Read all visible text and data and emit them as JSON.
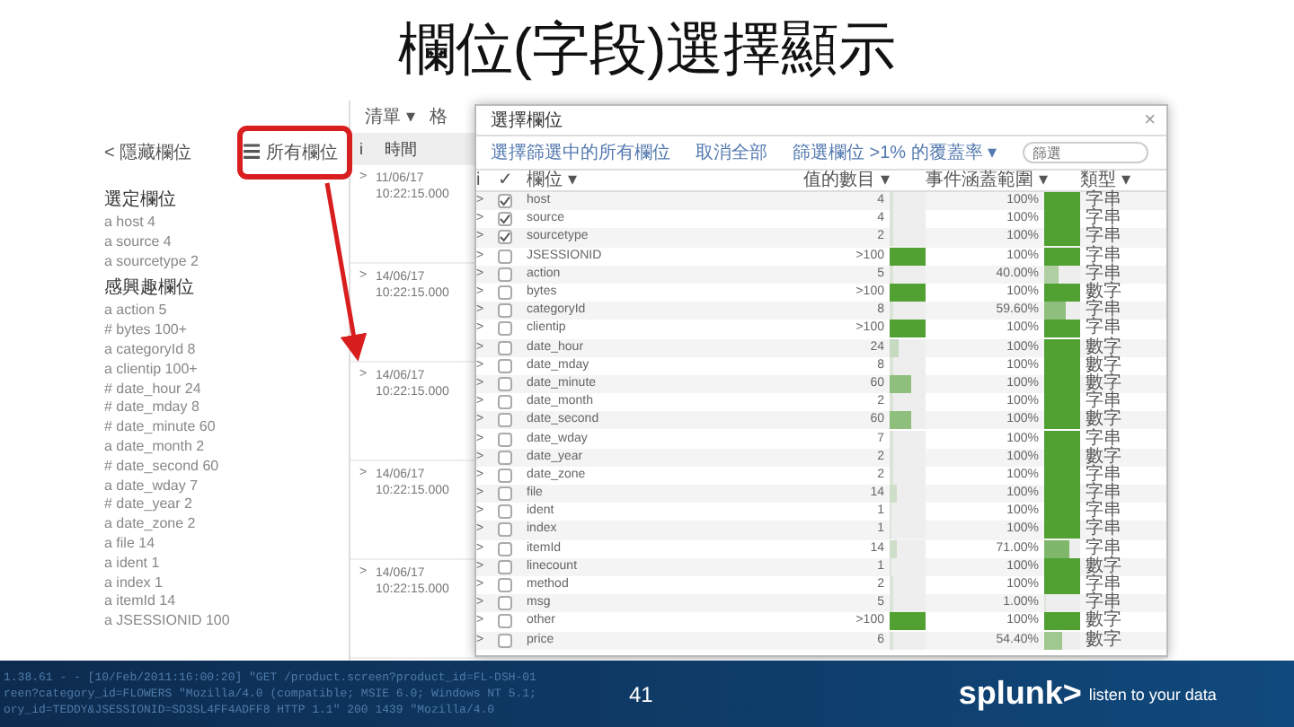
{
  "title": "欄位(字段)選擇顯示",
  "sidebar": {
    "hide_link": "< 隱藏欄位",
    "all_fields_button": "☰ 所有欄位",
    "sections": [
      {
        "heading": "選定欄位",
        "fields": [
          {
            "type": "a",
            "name": "host",
            "count": "4"
          },
          {
            "type": "a",
            "name": "source",
            "count": "4"
          },
          {
            "type": "a",
            "name": "sourcetype",
            "count": "2"
          }
        ]
      },
      {
        "heading": "感興趣欄位",
        "fields": [
          {
            "type": "a",
            "name": "action",
            "count": "5"
          },
          {
            "type": "#",
            "name": "bytes",
            "count": "100+"
          },
          {
            "type": "a",
            "name": "categoryId",
            "count": "8"
          },
          {
            "type": "a",
            "name": "clientip",
            "count": "100+"
          },
          {
            "type": "#",
            "name": "date_hour",
            "count": "24"
          },
          {
            "type": "#",
            "name": "date_mday",
            "count": "8"
          },
          {
            "type": "#",
            "name": "date_minute",
            "count": "60"
          },
          {
            "type": "a",
            "name": "date_month",
            "count": "2"
          },
          {
            "type": "#",
            "name": "date_second",
            "count": "60"
          },
          {
            "type": "a",
            "name": "date_wday",
            "count": "7"
          },
          {
            "type": "#",
            "name": "date_year",
            "count": "2"
          },
          {
            "type": "a",
            "name": "date_zone",
            "count": "2"
          },
          {
            "type": "a",
            "name": "file",
            "count": "14"
          },
          {
            "type": "a",
            "name": "ident",
            "count": "1"
          },
          {
            "type": "a",
            "name": "index",
            "count": "1"
          },
          {
            "type": "a",
            "name": "itemId",
            "count": "14"
          },
          {
            "type": "a",
            "name": "JSESSIONID",
            "count": "100"
          }
        ]
      }
    ]
  },
  "events": {
    "menus": [
      "清單 ▾",
      "格"
    ],
    "columns": [
      "i",
      "時間"
    ],
    "rows": [
      {
        "expander": ">",
        "date": "11/06/17",
        "time": "10:22:15.000"
      },
      {
        "expander": ">",
        "date": "14/06/17",
        "time": "10:22:15.000"
      },
      {
        "expander": ">",
        "date": "14/06/17",
        "time": "10:22:15.000"
      },
      {
        "expander": ">",
        "date": "14/06/17",
        "time": "10:22:15.000"
      },
      {
        "expander": ">",
        "date": "14/06/17",
        "time": "10:22:15.000"
      }
    ]
  },
  "dialog": {
    "title": "選擇欄位",
    "close": "×",
    "actions": [
      "選擇篩選中的所有欄位",
      "取消全部",
      "篩選欄位 >1% 的覆蓋率 ▾"
    ],
    "search": {
      "placeholder": "篩選"
    },
    "columns": [
      "i",
      "✓",
      "欄位 ▾",
      "值的數目 ▾",
      "事件涵蓋範圍 ▾",
      "類型 ▾"
    ],
    "row_expander": ">",
    "rows": [
      {
        "name": "host",
        "checked": true,
        "count": {
          "text": "4",
          "level": 0.1
        },
        "coverage": {
          "text": "100%",
          "level": 1
        },
        "type": "字串"
      },
      {
        "name": "source",
        "checked": true,
        "count": {
          "text": "4",
          "level": 0.1
        },
        "coverage": {
          "text": "100%",
          "level": 1
        },
        "type": "字串"
      },
      {
        "name": "sourcetype",
        "checked": true,
        "count": {
          "text": "2",
          "level": 0.1
        },
        "coverage": {
          "text": "100%",
          "level": 1
        },
        "type": "字串"
      },
      {
        "name": "JSESSIONID",
        "checked": false,
        "count": {
          "text": ">100",
          "level": 1
        },
        "coverage": {
          "text": "100%",
          "level": 1
        },
        "type": "字串"
      },
      {
        "name": "action",
        "checked": false,
        "count": {
          "text": "5",
          "level": 0.1
        },
        "coverage": {
          "text": "40.00%",
          "level": 0.4
        },
        "type": "字串"
      },
      {
        "name": "bytes",
        "checked": false,
        "count": {
          "text": ">100",
          "level": 1
        },
        "coverage": {
          "text": "100%",
          "level": 1
        },
        "type": "數字"
      },
      {
        "name": "categoryId",
        "checked": false,
        "count": {
          "text": "8",
          "level": 0.1
        },
        "coverage": {
          "text": "59.60%",
          "level": 0.6
        },
        "type": "字串"
      },
      {
        "name": "clientip",
        "checked": false,
        "count": {
          "text": ">100",
          "level": 1
        },
        "coverage": {
          "text": "100%",
          "level": 1
        },
        "type": "字串"
      },
      {
        "name": "date_hour",
        "checked": false,
        "count": {
          "text": "24",
          "level": 0.25
        },
        "coverage": {
          "text": "100%",
          "level": 1
        },
        "type": "數字"
      },
      {
        "name": "date_mday",
        "checked": false,
        "count": {
          "text": "8",
          "level": 0.1
        },
        "coverage": {
          "text": "100%",
          "level": 1
        },
        "type": "數字"
      },
      {
        "name": "date_minute",
        "checked": false,
        "count": {
          "text": "60",
          "level": 0.6
        },
        "coverage": {
          "text": "100%",
          "level": 1
        },
        "type": "數字"
      },
      {
        "name": "date_month",
        "checked": false,
        "count": {
          "text": "2",
          "level": 0.1
        },
        "coverage": {
          "text": "100%",
          "level": 1
        },
        "type": "字串"
      },
      {
        "name": "date_second",
        "checked": false,
        "count": {
          "text": "60",
          "level": 0.6
        },
        "coverage": {
          "text": "100%",
          "level": 1
        },
        "type": "數字"
      },
      {
        "name": "date_wday",
        "checked": false,
        "count": {
          "text": "7",
          "level": 0.1
        },
        "coverage": {
          "text": "100%",
          "level": 1
        },
        "type": "字串"
      },
      {
        "name": "date_year",
        "checked": false,
        "count": {
          "text": "2",
          "level": 0.1
        },
        "coverage": {
          "text": "100%",
          "level": 1
        },
        "type": "數字"
      },
      {
        "name": "date_zone",
        "checked": false,
        "count": {
          "text": "2",
          "level": 0.1
        },
        "coverage": {
          "text": "100%",
          "level": 1
        },
        "type": "字串"
      },
      {
        "name": "file",
        "checked": false,
        "count": {
          "text": "14",
          "level": 0.2
        },
        "coverage": {
          "text": "100%",
          "level": 1
        },
        "type": "字串"
      },
      {
        "name": "ident",
        "checked": false,
        "count": {
          "text": "1",
          "level": 0.05
        },
        "coverage": {
          "text": "100%",
          "level": 1
        },
        "type": "字串"
      },
      {
        "name": "index",
        "checked": false,
        "count": {
          "text": "1",
          "level": 0.05
        },
        "coverage": {
          "text": "100%",
          "level": 1
        },
        "type": "字串"
      },
      {
        "name": "itemId",
        "checked": false,
        "count": {
          "text": "14",
          "level": 0.2
        },
        "coverage": {
          "text": "71.00%",
          "level": 0.7
        },
        "type": "字串"
      },
      {
        "name": "linecount",
        "checked": false,
        "count": {
          "text": "1",
          "level": 0.05
        },
        "coverage": {
          "text": "100%",
          "level": 1
        },
        "type": "數字"
      },
      {
        "name": "method",
        "checked": false,
        "count": {
          "text": "2",
          "level": 0.1
        },
        "coverage": {
          "text": "100%",
          "level": 1
        },
        "type": "字串"
      },
      {
        "name": "msg",
        "checked": false,
        "count": {
          "text": "5",
          "level": 0.1
        },
        "coverage": {
          "text": "1.00%",
          "level": 0.01
        },
        "type": "字串"
      },
      {
        "name": "other",
        "checked": false,
        "count": {
          "text": ">100",
          "level": 1
        },
        "coverage": {
          "text": "100%",
          "level": 1
        },
        "type": "數字"
      },
      {
        "name": "price",
        "checked": false,
        "count": {
          "text": "6",
          "level": 0.1
        },
        "coverage": {
          "text": "54.40%",
          "level": 0.5
        },
        "type": "數字"
      }
    ]
  },
  "footer": {
    "log_lines": [
      "1.38.61 - - [10/Feb/2011:16:00:20] \"GET /product.screen?product_id=FL-DSH-01",
      "reen?category_id=FLOWERS \"Mozilla/4.0 (compatible; MSIE 6.0; Windows NT 5.1;",
      "ory_id=TEDDY&JSESSIONID=SD3SL4FF4ADFF8 HTTP 1.1\" 200 1439 \"Mozilla/4.0"
    ],
    "page_number": "41",
    "logo": "splunk>",
    "tagline": "listen to your data"
  }
}
